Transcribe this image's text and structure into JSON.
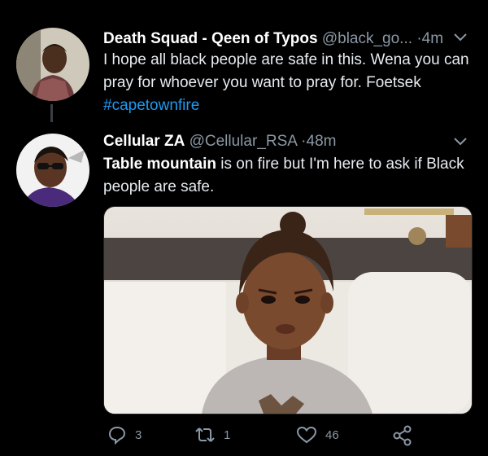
{
  "tweet1": {
    "name": "Death Squad - Qeen of Typos",
    "handle": "@black_go...",
    "dot": "·",
    "time": "4m",
    "text_line1": "I hope all black people are safe in this. Wena you can",
    "text_line2": "pray for whoever you want to pray for. Foetsek",
    "hashtag": "#capetownfire",
    "avatar_icon": "profile-photo-child"
  },
  "tweet2": {
    "name": "Cellular ZA",
    "handle": "@Cellular_RSA",
    "dot": "·",
    "time": "48m",
    "text_bold": "Table mountain",
    "text_rest": " is on fire but I'm here to ask if Black",
    "text_line2": "people are safe.",
    "avatar_icon": "profile-photo-sunglasses",
    "media_icon": "photo-frowning-child"
  },
  "actions": {
    "reply_count": "3",
    "retweet_count": "1",
    "like_count": "46"
  },
  "colors": {
    "background": "#000000",
    "text": "#e6ecf0",
    "muted": "#8b98a5",
    "link": "#1d9bf0"
  }
}
